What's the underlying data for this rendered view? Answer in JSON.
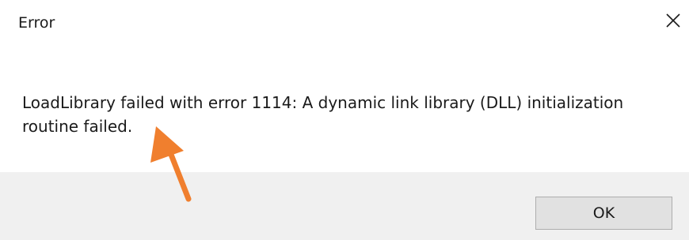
{
  "dialog": {
    "title": "Error",
    "close_icon": "close-icon",
    "message": "LoadLibrary failed with error 1114: A dynamic link library (DLL) initialization routine failed.",
    "ok_label": "OK"
  },
  "annotation": {
    "arrow_icon": "arrow-annotation",
    "arrow_color": "#f07f2e"
  },
  "colors": {
    "button_area": "#f0f0f0",
    "button_face": "#e1e1e1",
    "button_border": "#adadad"
  }
}
